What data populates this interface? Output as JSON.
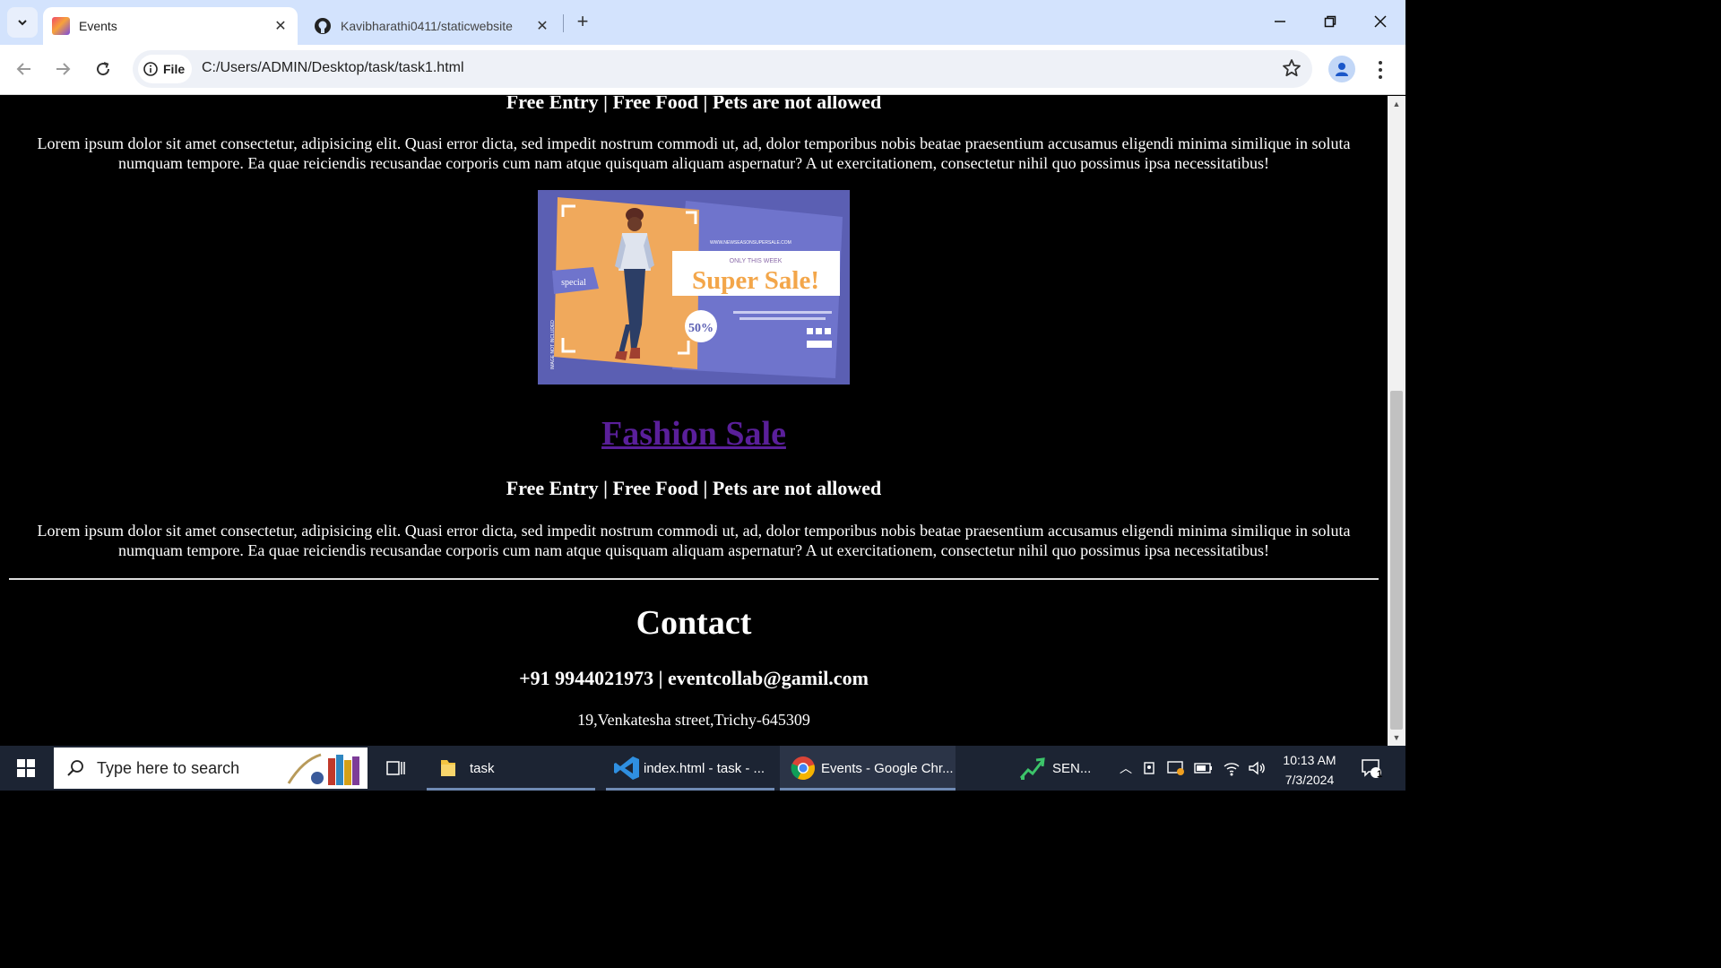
{
  "browser": {
    "tabs": [
      {
        "title": "Events",
        "active": true
      },
      {
        "title": "Kavibharathi0411/staticwebsite",
        "active": false
      }
    ],
    "site_chip_label": "File",
    "url": "C:/Users/ADMIN/Desktop/task/task1.html"
  },
  "page": {
    "top_info": "Free Entry | Free Food | Pets are not allowed",
    "lorem": "Lorem ipsum dolor sit amet consectetur, adipisicing elit. Quasi error dicta, sed impedit nostrum commodi ut, ad, dolor temporibus nobis beatae praesentium accusamus eligendi minima similique in soluta numquam tempore. Ea quae reiciendis recusandae corporis cum nam atque quisquam aliquam aspernatur? A ut exercitationem, consectetur nihil quo possimus ipsa necessitatibus!",
    "poster": {
      "url_text": "WWW.NEWSEASONSUPERSALE.COM",
      "tagline": "ONLY THIS WEEK",
      "headline": "Super Sale!",
      "tag": "special",
      "discount": "50%"
    },
    "event": {
      "title": "Fashion Sale",
      "info": "Free Entry | Free Food | Pets are not allowed",
      "description": "Lorem ipsum dolor sit amet consectetur, adipisicing elit. Quasi error dicta, sed impedit nostrum commodi ut, ad, dolor temporibus nobis beatae praesentium accusamus eligendi minima similique in soluta numquam tempore. Ea quae reiciendis recusandae corporis cum nam atque quisquam aliquam aspernatur? A ut exercitationem, consectetur nihil quo possimus ipsa necessitatibus!"
    },
    "contact": {
      "heading": "Contact",
      "line": "+91 9944021973 | eventcollab@gamil.com",
      "address": "19,Venkatesha street,Trichy-645309"
    }
  },
  "taskbar": {
    "search_placeholder": "Type here to search",
    "apps": [
      {
        "label": "task",
        "icon": "folder-icon"
      },
      {
        "label": "index.html - task - ...",
        "icon": "vscode-icon"
      },
      {
        "label": "Events - Google Chr...",
        "icon": "chrome-icon"
      },
      {
        "label": "SEN...",
        "icon": "stock-chart-icon"
      }
    ],
    "time": "10:13 AM",
    "date": "7/3/2024",
    "notification_count": "1"
  },
  "colors": {
    "tabstrip": "#d3e3fd",
    "page_bg": "#000000",
    "link_visited": "#5a1f9a",
    "taskbar": "#1c2433"
  }
}
